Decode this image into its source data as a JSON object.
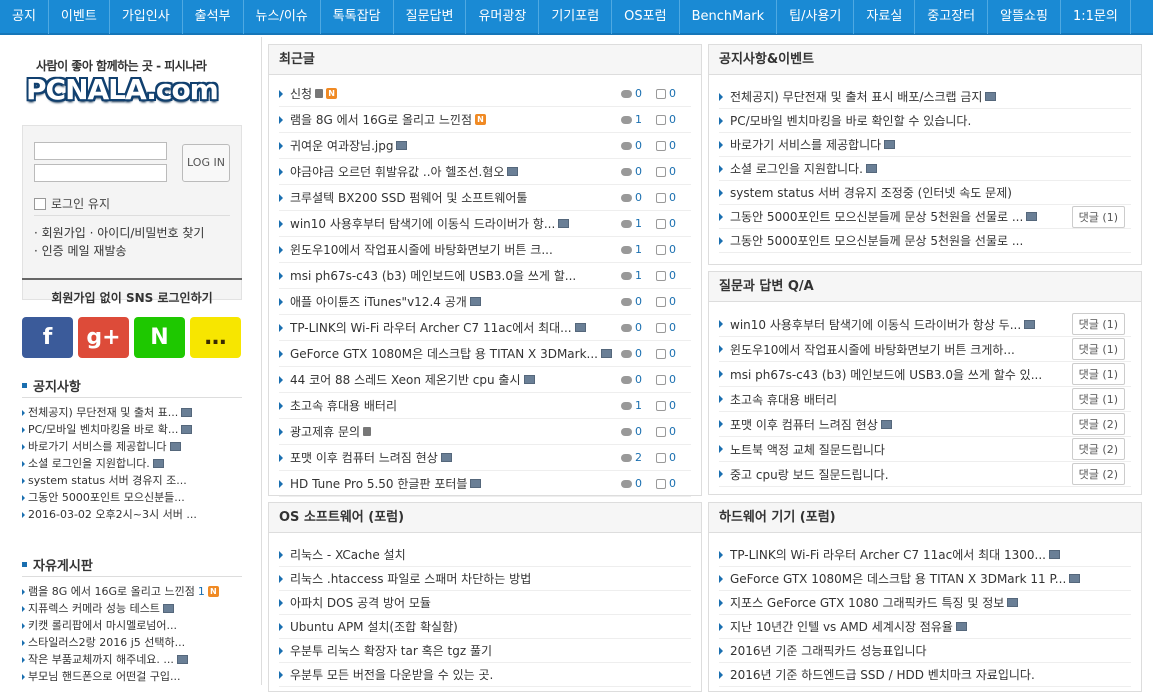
{
  "nav": [
    "공지",
    "이벤트",
    "가입인사",
    "출석부",
    "뉴스/이슈",
    "톡톡잡담",
    "질문답변",
    "유머광장",
    "기기포럼",
    "OS포럼",
    "BenchMark",
    "팁/사용기",
    "자료실",
    "중고장터",
    "알뜰쇼핑",
    "1:1문의"
  ],
  "logo": {
    "tagline": "사람이 좋아 함께하는 곳 - 피시나라",
    "text": "PCNALA.com"
  },
  "login": {
    "button": "LOG IN",
    "keep": "로그인 유지",
    "join": "· 회원가입 · 아이디/비밀번호 찾기",
    "mail": "· 인증 메일 재발송"
  },
  "sns": {
    "title": "회원가입 없이 SNS 로그인하기",
    "icons": [
      "facebook-icon",
      "googleplus-icon",
      "naver-icon",
      "kakao-icon"
    ],
    "glyphs": [
      "f",
      "g+",
      "N",
      "…"
    ],
    "colors": [
      "#3b5b9a",
      "#dd4b39",
      "#1ec800",
      "#f7e600"
    ]
  },
  "notice_side": {
    "title": "공지사항",
    "items": [
      "전체공지) 무단전재 및 출처 표...",
      "PC/모바일 벤치마킹을 바로 확...",
      "바로가기 서비스를 제공합니다",
      "소셜 로그인을 지원합니다.",
      "system status 서버 경유지 조...",
      "그동안 5000포인트 모으신분들...",
      "2016-03-02 오후2시~3시 서버 ..."
    ]
  },
  "free_side": {
    "title": "자유게시판",
    "items": [
      "램을 8G 에서 16G로 올리고 느낀점",
      "지퓨렉스 커메라 성능 테스트",
      "키캣 롤리팝에서 마시멜로넘어...",
      "스타일러스2랑 2016 j5 선택하...",
      "작은 부품교체까지 해주네요. ...",
      "부모님 핸드폰으로 어떤걸 구입..."
    ],
    "count1": "1"
  },
  "recent": {
    "title": "최근글",
    "rows": [
      {
        "t": "신청",
        "c": "0",
        "l": "0",
        "ic": "lock-new"
      },
      {
        "t": "램을 8G 에서 16G로 올리고 느낀점",
        "c": "1",
        "l": "0",
        "ic": "new"
      },
      {
        "t": "귀여운 여과장님.jpg",
        "c": "0",
        "l": "0",
        "ic": "img"
      },
      {
        "t": "야금야금 오르던 휘발유값 ..아 헬조선.혐오",
        "c": "0",
        "l": "0",
        "ic": "img"
      },
      {
        "t": "크루셜텍 BX200 SSD 펌웨어 및 소프트웨어툴",
        "c": "0",
        "l": "0",
        "ic": ""
      },
      {
        "t": "win10 사용후부터 탐색기에 이동식 드라이버가 항...",
        "c": "1",
        "l": "0",
        "ic": "img"
      },
      {
        "t": "윈도우10에서 작업표시줄에 바탕화면보기 버튼 크...",
        "c": "1",
        "l": "0",
        "ic": ""
      },
      {
        "t": "msi ph67s-c43 (b3) 메인보드에 USB3.0을 쓰게 할...",
        "c": "1",
        "l": "0",
        "ic": ""
      },
      {
        "t": "애플 아이튠즈 iTunes\"v12.4 공개",
        "c": "0",
        "l": "0",
        "ic": "img"
      },
      {
        "t": "TP-LINK의 Wi-Fi 라우터 Archer C7 11ac에서 최대...",
        "c": "0",
        "l": "0",
        "ic": "img"
      },
      {
        "t": "GeForce GTX 1080M은 데스크탑 용 TITAN X 3DMark...",
        "c": "0",
        "l": "0",
        "ic": "img"
      },
      {
        "t": "44 코어 88 스레드 Xeon 제온기반 cpu 출시",
        "c": "0",
        "l": "0",
        "ic": "img"
      },
      {
        "t": "초고속 휴대용 배터리",
        "c": "1",
        "l": "0",
        "ic": ""
      },
      {
        "t": "광고제휴 문의",
        "c": "0",
        "l": "0",
        "ic": "lock"
      },
      {
        "t": "포맷 이후 컴퓨터 느려짐 현상",
        "c": "2",
        "l": "0",
        "ic": "img"
      },
      {
        "t": "HD Tune Pro 5.50 한글판 포터블",
        "c": "0",
        "l": "0",
        "ic": "img"
      }
    ]
  },
  "os": {
    "title": "OS 소프트웨어 (포럼)",
    "rows": [
      "리눅스 - XCache 설치",
      "리눅스 .htaccess 파일로 스패머 차단하는 방법",
      "아파치 DOS 공격 방어 모듈",
      "Ubuntu APM 설치(조합 확실함)",
      "우분투 리눅스 확장자 tar 혹은 tgz 풀기",
      "우분투 모든 버전을 다운받을 수 있는 곳."
    ]
  },
  "notice": {
    "title": "공지사항&이벤트",
    "rows": [
      {
        "t": "전체공지) 무단전재 및 출처 표시 배포/스크랩 금지",
        "ic": "img",
        "b": ""
      },
      {
        "t": "PC/모바일 벤치마킹을 바로 확인할 수 있습니다.",
        "ic": "",
        "b": ""
      },
      {
        "t": "바로가기 서비스를 제공합니다",
        "ic": "img",
        "b": ""
      },
      {
        "t": "소셜 로그인을 지원합니다.",
        "ic": "img",
        "b": ""
      },
      {
        "t": "system status 서버 경유지 조정중 (인터넷 속도 문제)",
        "ic": "",
        "b": ""
      },
      {
        "t": "그동안 5000포인트 모으신분들께 문상 5천원을 선물로 ...",
        "ic": "img",
        "b": "댓글 (1)"
      },
      {
        "t": "그동안 5000포인트 모으신분들께 문상 5천원을 선물로 ...",
        "ic": "",
        "b": ""
      }
    ]
  },
  "qa": {
    "title": "질문과 답변 Q/A",
    "rows": [
      {
        "t": "win10 사용후부터 탐색기에 이동식 드라이버가 항상 두...",
        "ic": "img",
        "b": "댓글 (1)"
      },
      {
        "t": "윈도우10에서 작업표시줄에 바탕화면보기 버튼 크게하...",
        "ic": "",
        "b": "댓글 (1)"
      },
      {
        "t": "msi ph67s-c43 (b3) 메인보드에 USB3.0을 쓰게 할수 있...",
        "ic": "",
        "b": "댓글 (1)"
      },
      {
        "t": "초고속 휴대용 배터리",
        "ic": "",
        "b": "댓글 (1)"
      },
      {
        "t": "포맷 이후 컴퓨터 느려짐 현상",
        "ic": "img",
        "b": "댓글 (2)"
      },
      {
        "t": "노트북 액정 교체 질문드립니다",
        "ic": "",
        "b": "댓글 (2)"
      },
      {
        "t": "중고 cpu랑 보드 질문드립니다.",
        "ic": "",
        "b": "댓글 (2)"
      }
    ]
  },
  "hw": {
    "title": "하드웨어 기기 (포럼)",
    "rows": [
      {
        "t": "TP-LINK의 Wi-Fi 라우터 Archer C7 11ac에서 최대 1300...",
        "ic": "img"
      },
      {
        "t": "GeForce GTX 1080M은 데스크탑 용 TITAN X 3DMark 11 P...",
        "ic": "img"
      },
      {
        "t": "지포스 GeForce GTX 1080 그래픽카드 특징 및 정보",
        "ic": "img"
      },
      {
        "t": "지난 10년간 인텔 vs AMD 세계시장 점유율",
        "ic": "img"
      },
      {
        "t": "2016년 기준 그래픽카드 성능표입니다",
        "ic": ""
      },
      {
        "t": "2016년 기준 하드엔드급 SSD / HDD 벤치마크 자료입니다.",
        "ic": ""
      }
    ]
  }
}
